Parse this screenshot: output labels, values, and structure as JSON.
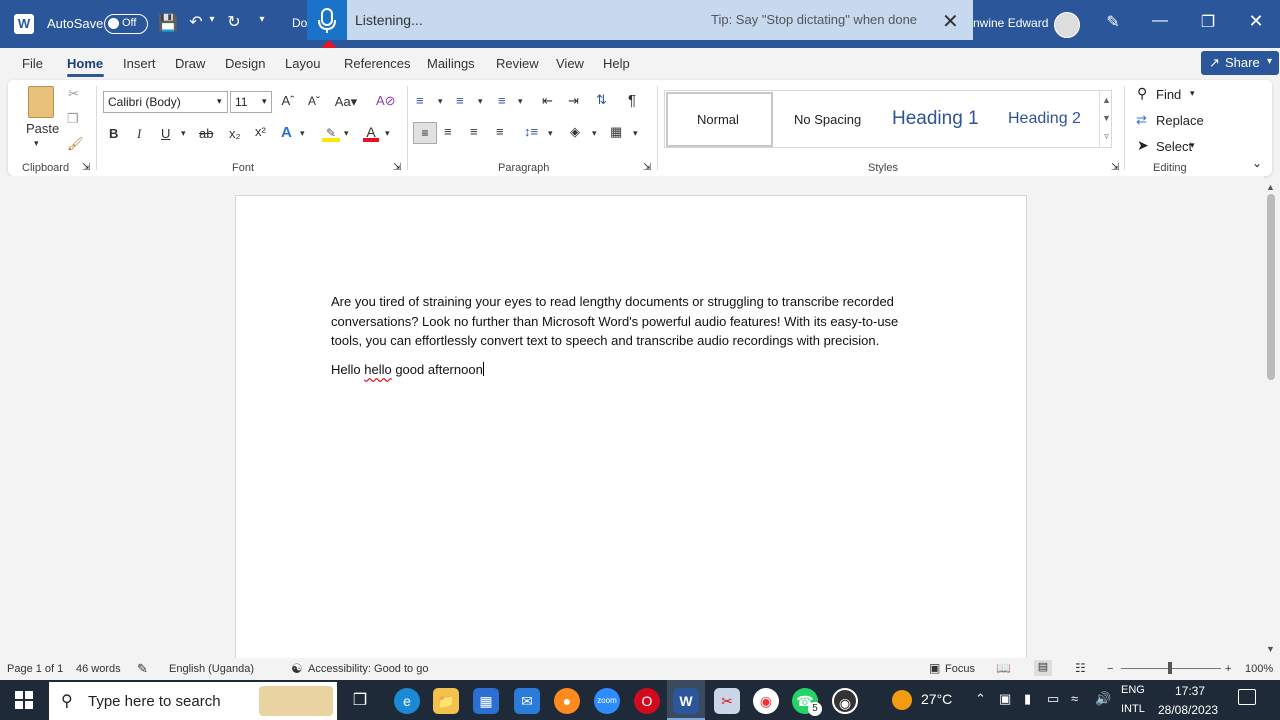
{
  "titlebar": {
    "autosave_label": "AutoSave",
    "autosave_state": "Off",
    "doc_title_partial": "Do",
    "user_name_partial": "nwine Edward"
  },
  "dictation": {
    "status": "Listening...",
    "tip": "Tip: Say \"Stop dictating\" when done"
  },
  "tabs": [
    "File",
    "Home",
    "Insert",
    "Draw",
    "Design",
    "Layout",
    "References",
    "Mailings",
    "Review",
    "View",
    "Help"
  ],
  "tabs_visible": {
    "layout": "Layou",
    "references": "References"
  },
  "share_label": "Share",
  "ribbon": {
    "clipboard": {
      "paste_label": "Paste",
      "group_label": "Clipboard"
    },
    "font": {
      "font_name": "Calibri (Body)",
      "font_size": "11",
      "group_label": "Font"
    },
    "paragraph": {
      "group_label": "Paragraph"
    },
    "styles": {
      "items": [
        "Normal",
        "No Spacing",
        "Heading 1",
        "Heading 2"
      ],
      "group_label": "Styles"
    },
    "editing": {
      "find": "Find",
      "replace": "Replace",
      "select": "Select",
      "group_label": "Editing"
    }
  },
  "document": {
    "paragraph1": "Are you tired of straining your eyes to read lengthy documents or struggling to transcribe recorded conversations? Look no further than Microsoft Word's powerful audio features! With its easy-to-use tools, you can effortlessly convert text to speech and transcribe audio recordings with precision.",
    "line2_a": "Hello ",
    "line2_b": "hello",
    "line2_c": " good afternoon"
  },
  "status": {
    "page": "Page 1 of 1",
    "words": "46 words",
    "language": "English (Uganda)",
    "accessibility": "Accessibility: Good to go",
    "focus": "Focus",
    "zoom": "100%"
  },
  "taskbar": {
    "search_placeholder": "Type here to search",
    "weather": "27°C",
    "lang_top": "ENG",
    "lang_bottom": "INTL",
    "time": "17:37",
    "date": "28/08/2023",
    "whatsapp_badge": "5"
  },
  "colors": {
    "accent": "#2b579a",
    "dictation_bg": "#c7d9ef",
    "mic": "#1a73c9",
    "arrow": "#e81123"
  }
}
